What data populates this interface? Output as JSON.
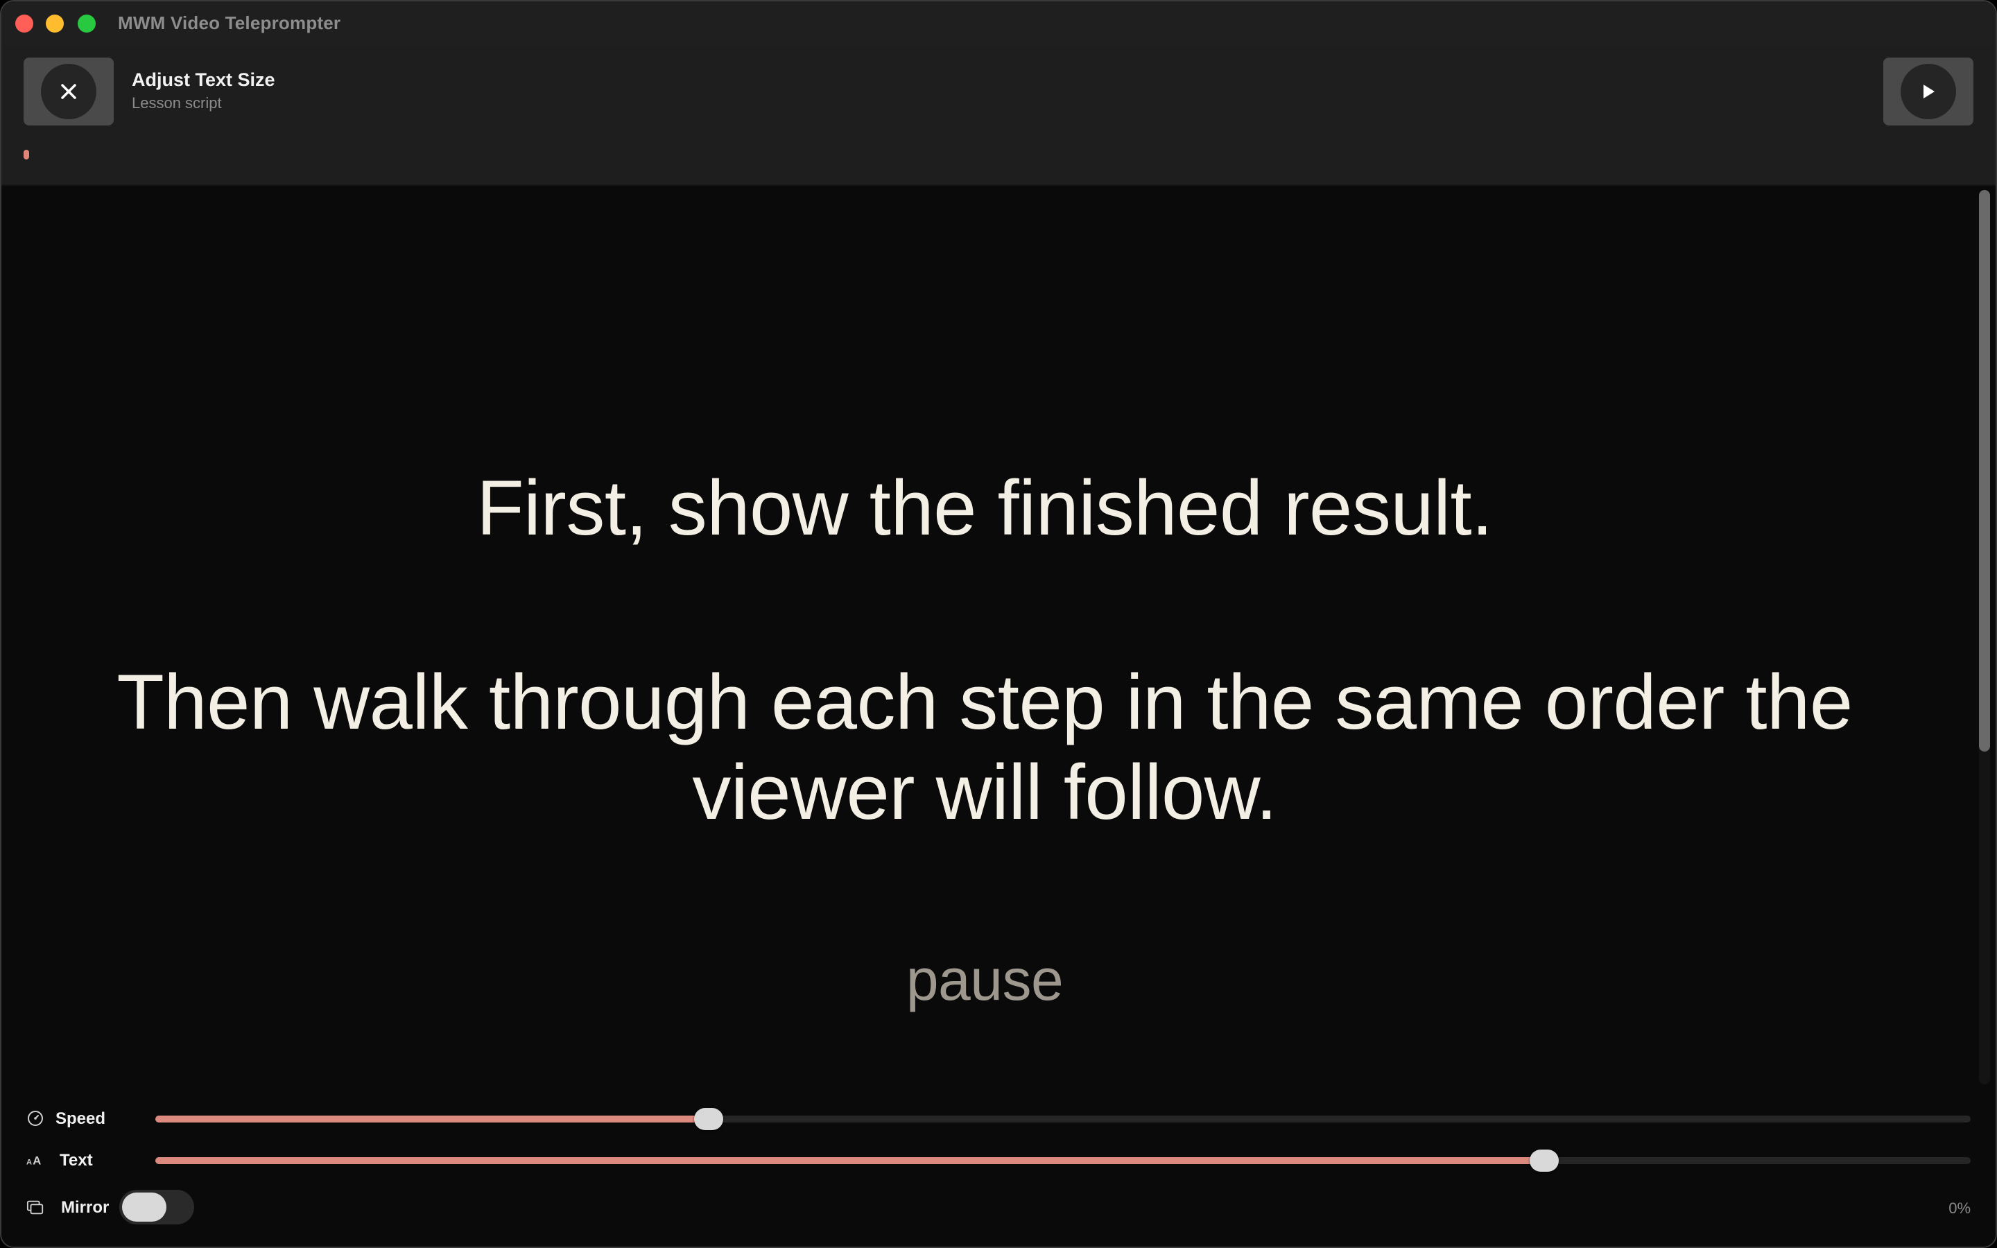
{
  "window": {
    "title": "MWM Video Teleprompter"
  },
  "header": {
    "title": "Adjust Text Size",
    "subtitle": "Lesson script",
    "close_icon": "close-icon",
    "play_icon": "play-icon",
    "progress": 0
  },
  "script": {
    "paragraphs": [
      "First, show the finished result.",
      "Then walk through each step in the same order the viewer will follow."
    ],
    "pause_label": "pause"
  },
  "controls": {
    "speed": {
      "label": "Speed",
      "icon": "speedometer-icon",
      "value": 0.305
    },
    "text": {
      "label": "Text",
      "icon": "text-size-icon",
      "value": 0.765
    },
    "mirror": {
      "label": "Mirror",
      "icon": "mirror-icon",
      "enabled": false
    },
    "progress_label": "0%"
  },
  "colors": {
    "accent": "#dd8a7e",
    "text": "#f3efe4",
    "pause_text": "#9d978d",
    "background": "#0a0a0a"
  }
}
